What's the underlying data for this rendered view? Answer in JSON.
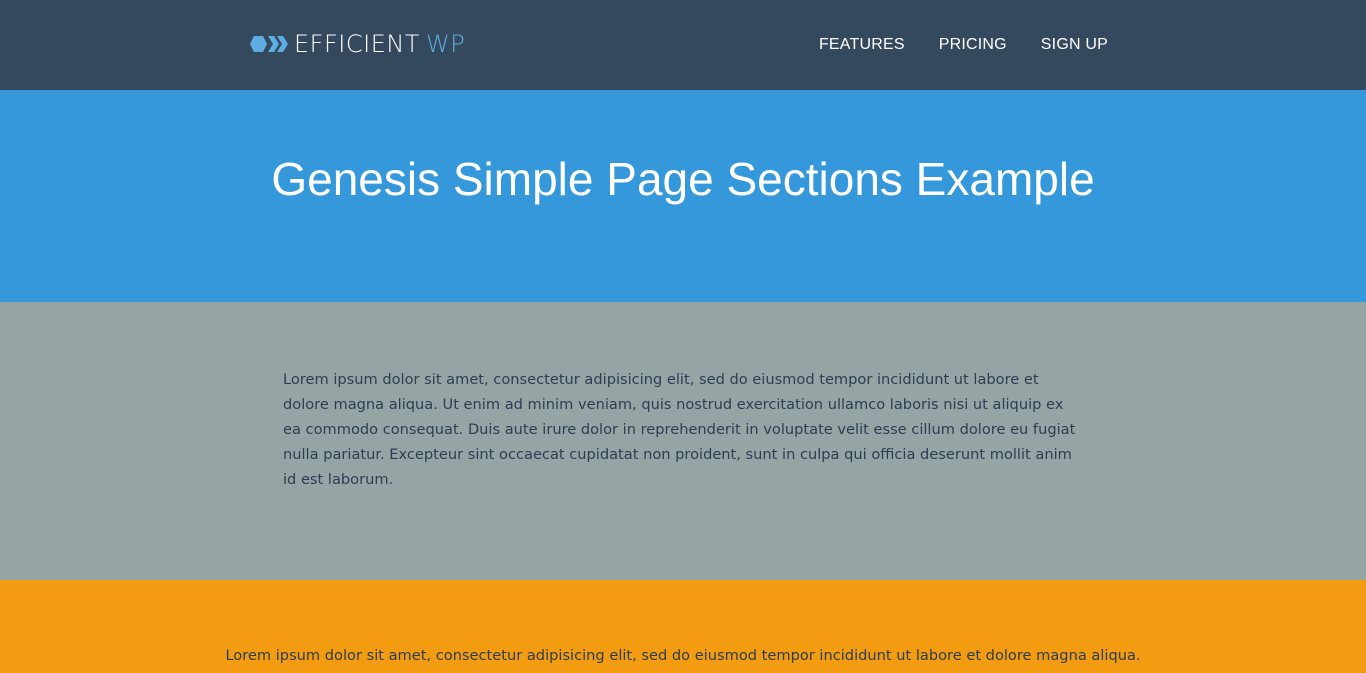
{
  "header": {
    "logo_icon": "hexagon-chevrons-icon",
    "logo_word_1": "EFFICIENT",
    "logo_word_2": "WP",
    "nav": [
      {
        "label": "FEATURES"
      },
      {
        "label": "PRICING"
      },
      {
        "label": "SIGN UP"
      }
    ]
  },
  "hero": {
    "title": "Genesis Simple Page Sections Example"
  },
  "section_gray": {
    "text": "Lorem ipsum dolor sit amet, consectetur adipisicing elit, sed do eiusmod tempor incididunt ut labore et dolore magna aliqua. Ut enim ad minim veniam, quis nostrud exercitation ullamco laboris nisi ut aliquip ex ea commodo consequat. Duis aute irure dolor in reprehenderit in voluptate velit esse cillum dolore eu fugiat nulla pariatur. Excepteur sint occaecat cupidatat non proident, sunt in culpa qui officia deserunt mollit anim id est laborum."
  },
  "section_orange": {
    "text": "Lorem ipsum dolor sit amet, consectetur adipisicing elit, sed do eiusmod tempor incididunt ut labore et dolore magna aliqua."
  },
  "colors": {
    "header_bg": "#34495e",
    "hero_bg": "#3498db",
    "gray_bg": "#95a5a6",
    "orange_bg": "#f39c12",
    "accent": "#5dade2",
    "body_text": "#2c3e50"
  }
}
